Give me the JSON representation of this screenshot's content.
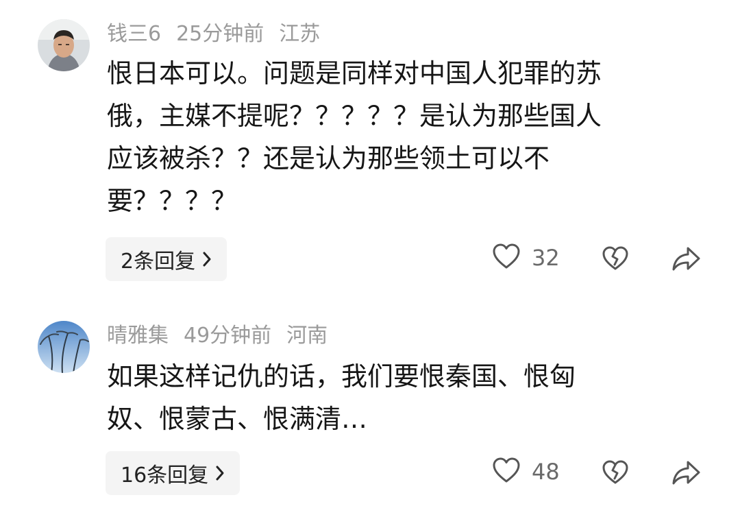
{
  "comments": [
    {
      "username": "钱三6",
      "time": "25分钟前",
      "location": "江苏",
      "lines": [
        "恨日本可以。问题是同样对中国人犯罪的苏",
        "俄，主媒不提呢？？？？？是认为那些国人",
        "应该被杀？？还是认为那些领土可以不",
        "要？？？？"
      ],
      "replies_label": "2条回复",
      "likes": "32"
    },
    {
      "username": "晴雅集",
      "time": "49分钟前",
      "location": "河南",
      "lines": [
        "如果这样记仇的话，我们要恨秦国、恨匈",
        "奴、恨蒙古、恨满清…"
      ],
      "replies_label": "16条回复",
      "likes": "48"
    }
  ],
  "icons": {
    "like": "heart-outline-icon",
    "dislike": "broken-heart-icon",
    "share": "share-arrow-icon",
    "chevron": "chevron-right-icon"
  },
  "colors": {
    "text": "#161616",
    "meta": "#9a9a9a",
    "button_bg": "#f4f4f4",
    "icon": "#555555"
  }
}
